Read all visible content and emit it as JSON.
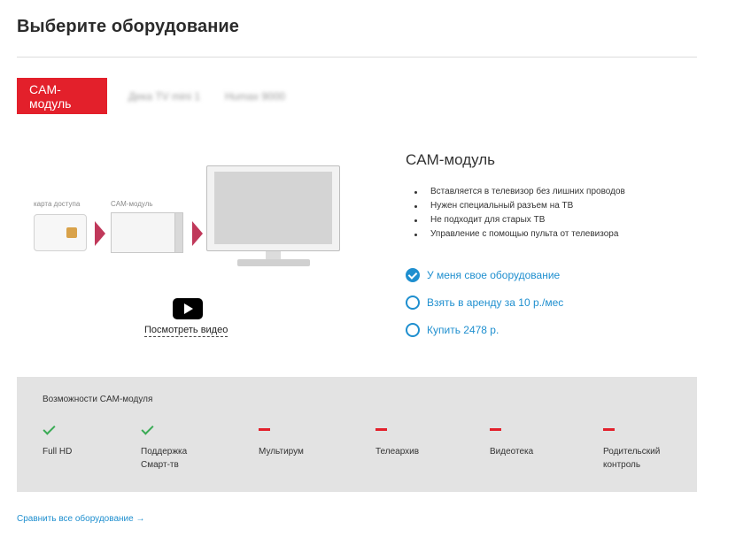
{
  "header": {
    "title": "Выберите оборудование"
  },
  "tabs": [
    {
      "label": "CAM-модуль",
      "active": true
    },
    {
      "label": "Дека TV mini 1",
      "active": false
    },
    {
      "label": "Humax 9000",
      "active": false
    }
  ],
  "illustration": {
    "card_caption": "карта доступа",
    "module_caption": "CAM-модуль",
    "video_link": "Посмотреть видео",
    "video_icon": "play-icon"
  },
  "product": {
    "title": "CAM-модуль",
    "features": [
      "Вставляется в телевизор без лишних проводов",
      "Нужен специальный разъем на ТВ",
      "Не подходит для старых ТВ",
      "Управление с помощью пульта от телевизора"
    ],
    "options": [
      {
        "label": "У меня свое оборудование",
        "checked": true
      },
      {
        "label": "Взять в аренду за 10 р./мес",
        "checked": false
      },
      {
        "label": "Купить 2478 р.",
        "checked": false
      }
    ]
  },
  "capabilities": {
    "title": "Возможности CAM-модуля",
    "items": [
      {
        "label": "Full HD",
        "available": true
      },
      {
        "label": "Поддержка\nСмарт-тв",
        "available": true
      },
      {
        "label": "Мультирум",
        "available": false
      },
      {
        "label": "Телеархив",
        "available": false
      },
      {
        "label": "Видеотека",
        "available": false
      },
      {
        "label": "Родительский\nконтроль",
        "available": false
      }
    ]
  },
  "footer": {
    "compare_link": "Сравнить все оборудование →"
  },
  "colors": {
    "accent_red": "#e3202b",
    "link_blue": "#1f8fcf",
    "check_green": "#3aab55",
    "panel_gray": "#e3e3e3"
  }
}
